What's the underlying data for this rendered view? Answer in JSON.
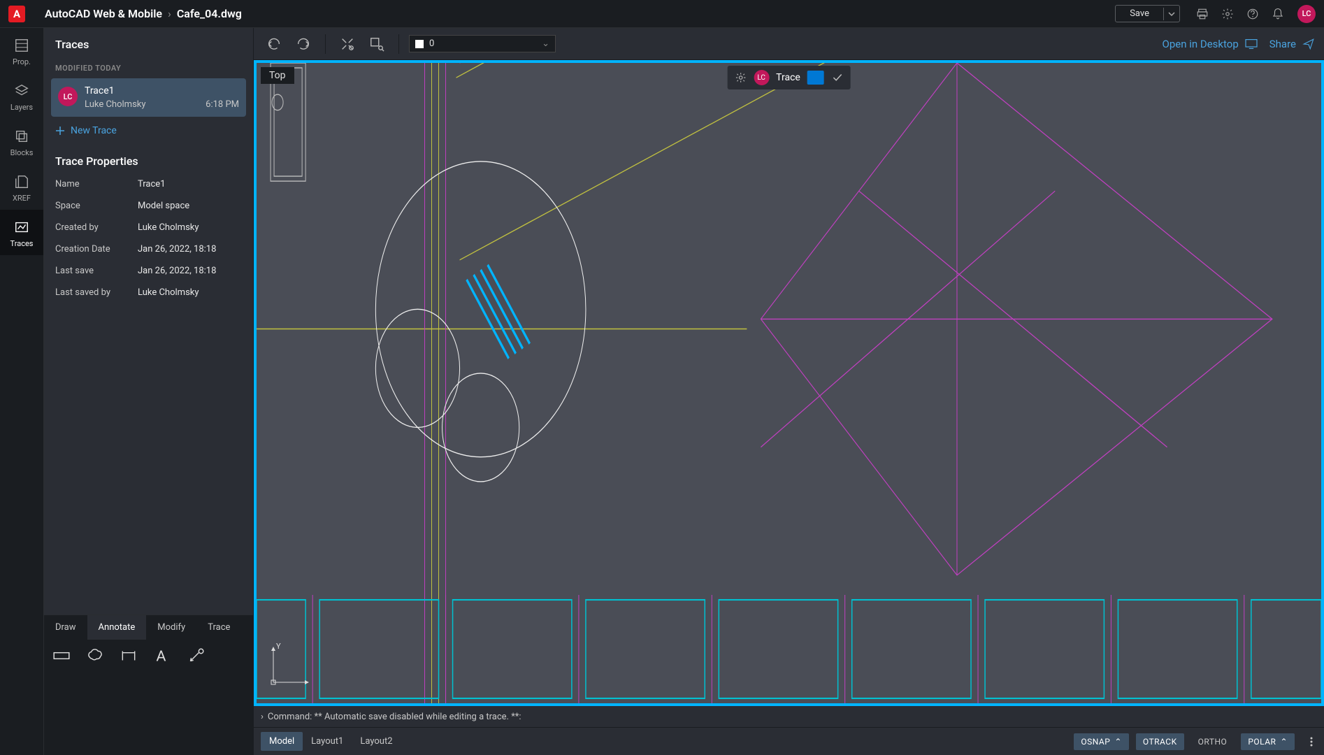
{
  "header": {
    "app_name": "AutoCAD Web & Mobile",
    "file_name": "Cafe_04.dwg",
    "save_label": "Save",
    "avatar_initials": "LC"
  },
  "nav": {
    "items": [
      {
        "label": "Prop."
      },
      {
        "label": "Layers"
      },
      {
        "label": "Blocks"
      },
      {
        "label": "XREF"
      },
      {
        "label": "Traces"
      }
    ]
  },
  "traces_panel": {
    "title": "Traces",
    "modified_section": "MODIFIED TODAY",
    "item": {
      "avatar": "LC",
      "name": "Trace1",
      "author": "Luke Cholmsky",
      "time": "6:18 PM"
    },
    "new_trace_label": "New Trace",
    "properties_title": "Trace Properties",
    "properties": [
      {
        "label": "Name",
        "value": "Trace1"
      },
      {
        "label": "Space",
        "value": "Model space"
      },
      {
        "label": "Created by",
        "value": "Luke Cholmsky"
      },
      {
        "label": "Creation Date",
        "value": "Jan 26, 2022, 18:18"
      },
      {
        "label": "Last save",
        "value": "Jan 26, 2022, 18:18"
      },
      {
        "label": "Last saved by",
        "value": "Luke Cholmsky"
      }
    ]
  },
  "panel_tabs": [
    "Draw",
    "Annotate",
    "Modify",
    "Trace"
  ],
  "main_toolbar": {
    "layer_name": "0",
    "open_desktop": "Open in Desktop",
    "share": "Share"
  },
  "canvas": {
    "view_badge": "Top",
    "trace_toolbar": {
      "avatar": "LC",
      "label": "Trace"
    },
    "ucs_y": "Y"
  },
  "command": {
    "text": "Command: ** Automatic save disabled while editing a trace. **:"
  },
  "bottom": {
    "layouts": [
      "Model",
      "Layout1",
      "Layout2"
    ],
    "snaps": [
      {
        "label": "OSNAP",
        "chevron": true,
        "active": true
      },
      {
        "label": "OTRACK",
        "chevron": false,
        "active": true
      },
      {
        "label": "ORTHO",
        "chevron": false,
        "active": false
      },
      {
        "label": "POLAR",
        "chevron": true,
        "active": true
      }
    ]
  }
}
